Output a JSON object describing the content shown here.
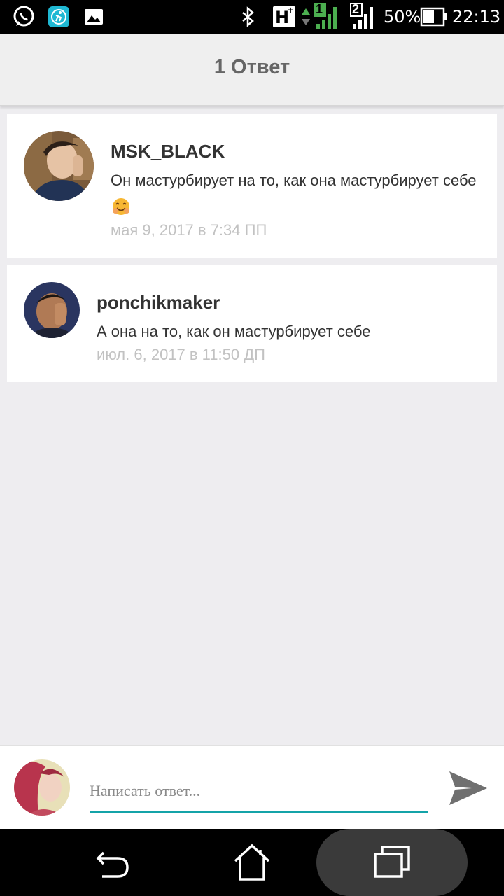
{
  "status_bar": {
    "battery_percent": "50%",
    "time": "22:13",
    "network_type": "H",
    "network_plus": "+",
    "sim1_label": "1",
    "sim2_label": "2"
  },
  "header": {
    "title": "1 Ответ"
  },
  "comments": [
    {
      "username": "MSK_BLACK",
      "text": "Он мастурбирует на то, как она мастурбирует себе",
      "emoji": "smiling-face-icon",
      "timestamp": "мая 9, 2017 в 7:34 ПП"
    },
    {
      "username": "ponchikmaker",
      "text": "А она на то, как он мастурбирует себе",
      "timestamp": "июл. 6, 2017 в 11:50 ДП"
    }
  ],
  "reply": {
    "placeholder": "Написать ответ...",
    "value": ""
  },
  "colors": {
    "accent": "#14a3a8",
    "background": "#eeedf0",
    "card": "#ffffff",
    "text": "#333333",
    "timestamp": "#c2c2c2"
  }
}
